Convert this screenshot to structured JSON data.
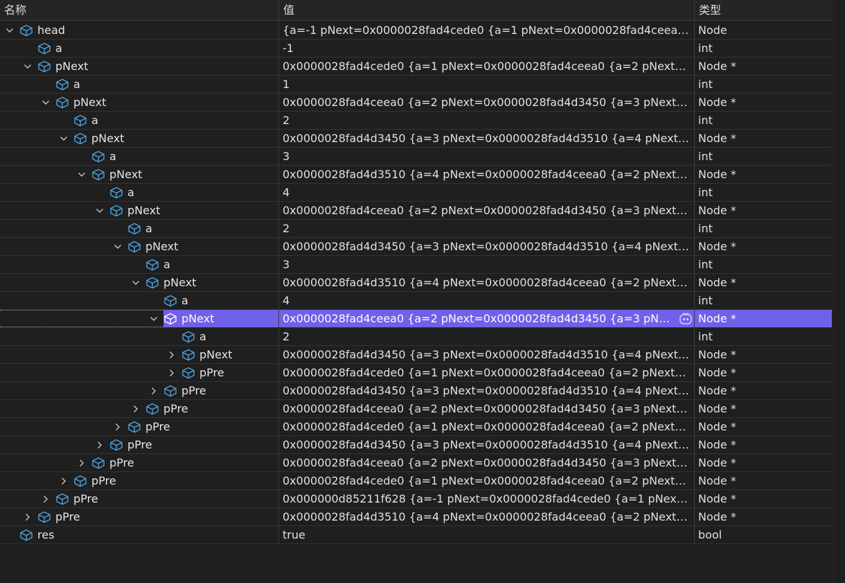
{
  "header": {
    "name": "名称",
    "value": "值",
    "type": "类型"
  },
  "rows": [
    {
      "level": 0,
      "expand": "open",
      "name": "head",
      "value": "{a=-1 pNext=0x0000028fad4cede0 {a=1 pNext=0x0000028fad4ceea0 {a=...",
      "type": "Node"
    },
    {
      "level": 1,
      "expand": "none",
      "name": "a",
      "value": "-1",
      "type": "int"
    },
    {
      "level": 1,
      "expand": "open",
      "name": "pNext",
      "value": "0x0000028fad4cede0 {a=1 pNext=0x0000028fad4ceea0 {a=2 pNext=0x0...",
      "type": "Node *"
    },
    {
      "level": 2,
      "expand": "none",
      "name": "a",
      "value": "1",
      "type": "int"
    },
    {
      "level": 2,
      "expand": "open",
      "name": "pNext",
      "value": "0x0000028fad4ceea0 {a=2 pNext=0x0000028fad4d3450 {a=3 pNext=0x0...",
      "type": "Node *"
    },
    {
      "level": 3,
      "expand": "none",
      "name": "a",
      "value": "2",
      "type": "int"
    },
    {
      "level": 3,
      "expand": "open",
      "name": "pNext",
      "value": "0x0000028fad4d3450 {a=3 pNext=0x0000028fad4d3510 {a=4 pNext=0x...",
      "type": "Node *"
    },
    {
      "level": 4,
      "expand": "none",
      "name": "a",
      "value": "3",
      "type": "int"
    },
    {
      "level": 4,
      "expand": "open",
      "name": "pNext",
      "value": "0x0000028fad4d3510 {a=4 pNext=0x0000028fad4ceea0 {a=2 pNext=0x0...",
      "type": "Node *"
    },
    {
      "level": 5,
      "expand": "none",
      "name": "a",
      "value": "4",
      "type": "int"
    },
    {
      "level": 5,
      "expand": "open",
      "name": "pNext",
      "value": "0x0000028fad4ceea0 {a=2 pNext=0x0000028fad4d3450 {a=3 pNext=0x0...",
      "type": "Node *"
    },
    {
      "level": 6,
      "expand": "none",
      "name": "a",
      "value": "2",
      "type": "int"
    },
    {
      "level": 6,
      "expand": "open",
      "name": "pNext",
      "value": "0x0000028fad4d3450 {a=3 pNext=0x0000028fad4d3510 {a=4 pNext=0x...",
      "type": "Node *"
    },
    {
      "level": 7,
      "expand": "none",
      "name": "a",
      "value": "3",
      "type": "int"
    },
    {
      "level": 7,
      "expand": "open",
      "name": "pNext",
      "value": "0x0000028fad4d3510 {a=4 pNext=0x0000028fad4ceea0 {a=2 pNext=0x0...",
      "type": "Node *"
    },
    {
      "level": 8,
      "expand": "none",
      "name": "a",
      "value": "4",
      "type": "int"
    },
    {
      "level": 8,
      "expand": "open",
      "name": "pNext",
      "value": "0x0000028fad4ceea0 {a=2 pNext=0x0000028fad4d3450 {a=3 pNext=...",
      "type": "Node *",
      "selected": true
    },
    {
      "level": 9,
      "expand": "none",
      "name": "a",
      "value": "2",
      "type": "int"
    },
    {
      "level": 9,
      "expand": "closed",
      "name": "pNext",
      "value": "0x0000028fad4d3450 {a=3 pNext=0x0000028fad4d3510 {a=4 pNext=0x...",
      "type": "Node *"
    },
    {
      "level": 9,
      "expand": "closed",
      "name": "pPre",
      "value": "0x0000028fad4cede0 {a=1 pNext=0x0000028fad4ceea0 {a=2 pNext=0x0...",
      "type": "Node *"
    },
    {
      "level": 8,
      "expand": "closed",
      "name": "pPre",
      "value": "0x0000028fad4d3450 {a=3 pNext=0x0000028fad4d3510 {a=4 pNext=0x...",
      "type": "Node *"
    },
    {
      "level": 7,
      "expand": "closed",
      "name": "pPre",
      "value": "0x0000028fad4ceea0 {a=2 pNext=0x0000028fad4d3450 {a=3 pNext=0x0...",
      "type": "Node *"
    },
    {
      "level": 6,
      "expand": "closed",
      "name": "pPre",
      "value": "0x0000028fad4cede0 {a=1 pNext=0x0000028fad4ceea0 {a=2 pNext=0x0...",
      "type": "Node *"
    },
    {
      "level": 5,
      "expand": "closed",
      "name": "pPre",
      "value": "0x0000028fad4d3450 {a=3 pNext=0x0000028fad4d3510 {a=4 pNext=0x...",
      "type": "Node *"
    },
    {
      "level": 4,
      "expand": "closed",
      "name": "pPre",
      "value": "0x0000028fad4ceea0 {a=2 pNext=0x0000028fad4d3450 {a=3 pNext=0x0...",
      "type": "Node *"
    },
    {
      "level": 3,
      "expand": "closed",
      "name": "pPre",
      "value": "0x0000028fad4cede0 {a=1 pNext=0x0000028fad4ceea0 {a=2 pNext=0x0...",
      "type": "Node *"
    },
    {
      "level": 2,
      "expand": "closed",
      "name": "pPre",
      "value": "0x000000d85211f628 {a=-1 pNext=0x0000028fad4cede0 {a=1 pNext=0x...",
      "type": "Node *"
    },
    {
      "level": 1,
      "expand": "closed",
      "name": "pPre",
      "value": "0x0000028fad4d3510 {a=4 pNext=0x0000028fad4ceea0 {a=2 pNext=0x0...",
      "type": "Node *"
    },
    {
      "level": 0,
      "expand": "none",
      "name": "res",
      "value": "true",
      "type": "bool"
    }
  ],
  "icons": {
    "object": "cube-object-icon",
    "expand_open": "chevron-down-icon",
    "expand_closed": "chevron-right-icon",
    "copilot": "copilot-icon"
  },
  "colors": {
    "background": "#1f1f1f",
    "selection": "#7160e8",
    "icon_blue": "#4fa3e0"
  }
}
